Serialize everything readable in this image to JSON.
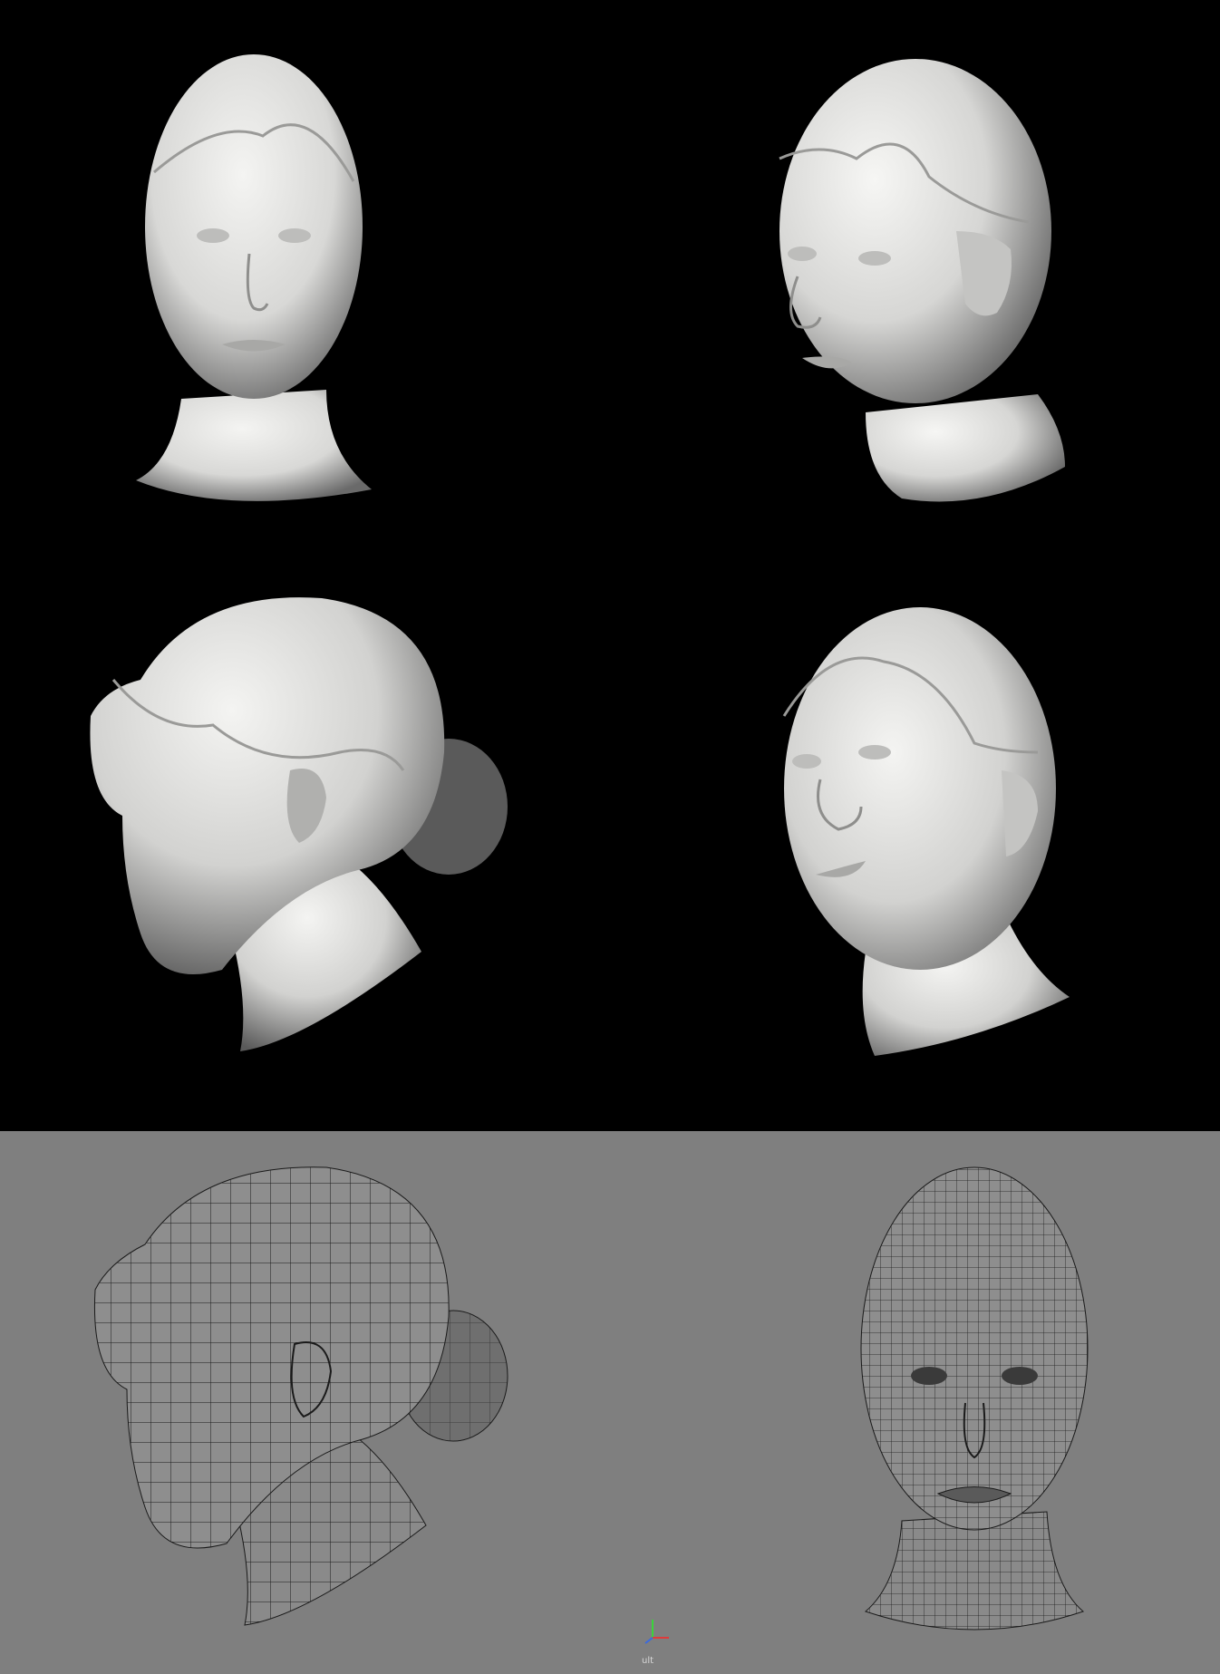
{
  "colors": {
    "render_background": "#000000",
    "viewport_background": "#7f7f7f",
    "shaded_surface": "#e6e6e4",
    "wire_surface": "#8a8a8a",
    "wire_color": "#1a1a1a",
    "axis_x": "#e03a3a",
    "axis_y": "#3ad43a",
    "axis_z": "#3a6ae0"
  },
  "icons": {
    "axis_gizmo": "xyz-axis-icon"
  },
  "viewport": {
    "camera_label": "ult"
  }
}
